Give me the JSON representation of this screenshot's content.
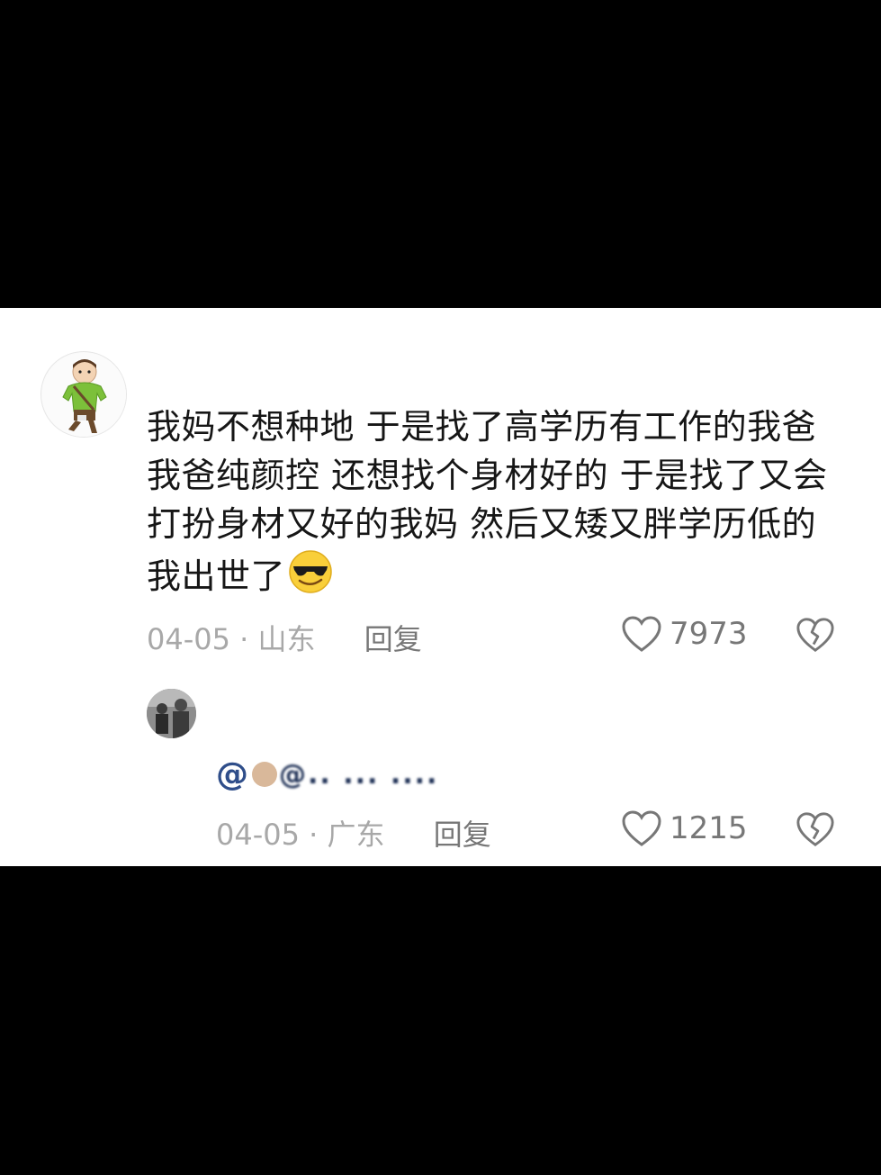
{
  "comment": {
    "text": "我妈不想种地 于是找了高学历有工作的我爸 我爸纯颜控 还想找个身材好的 于是找了又会打扮身材又好的我妈 然后又矮又胖学历低的我出世了",
    "emoji": "sunglasses-emoji",
    "date": "04-05",
    "separator": "·",
    "location": "山东",
    "reply_label": "回复",
    "likes": "7973"
  },
  "reply": {
    "name": "ㅤ",
    "mention_text": "@.. ... ....",
    "date": "04-05",
    "separator": "·",
    "location": "广东",
    "reply_label": "回复",
    "likes": "1215"
  },
  "icons": {
    "like": "heart-outline-icon",
    "dislike": "broken-heart-icon"
  },
  "colors": {
    "background_bars": "#000000",
    "panel": "#ffffff",
    "text": "#161616",
    "meta": "#a8a8a8",
    "mention": "#2f4e8a"
  }
}
